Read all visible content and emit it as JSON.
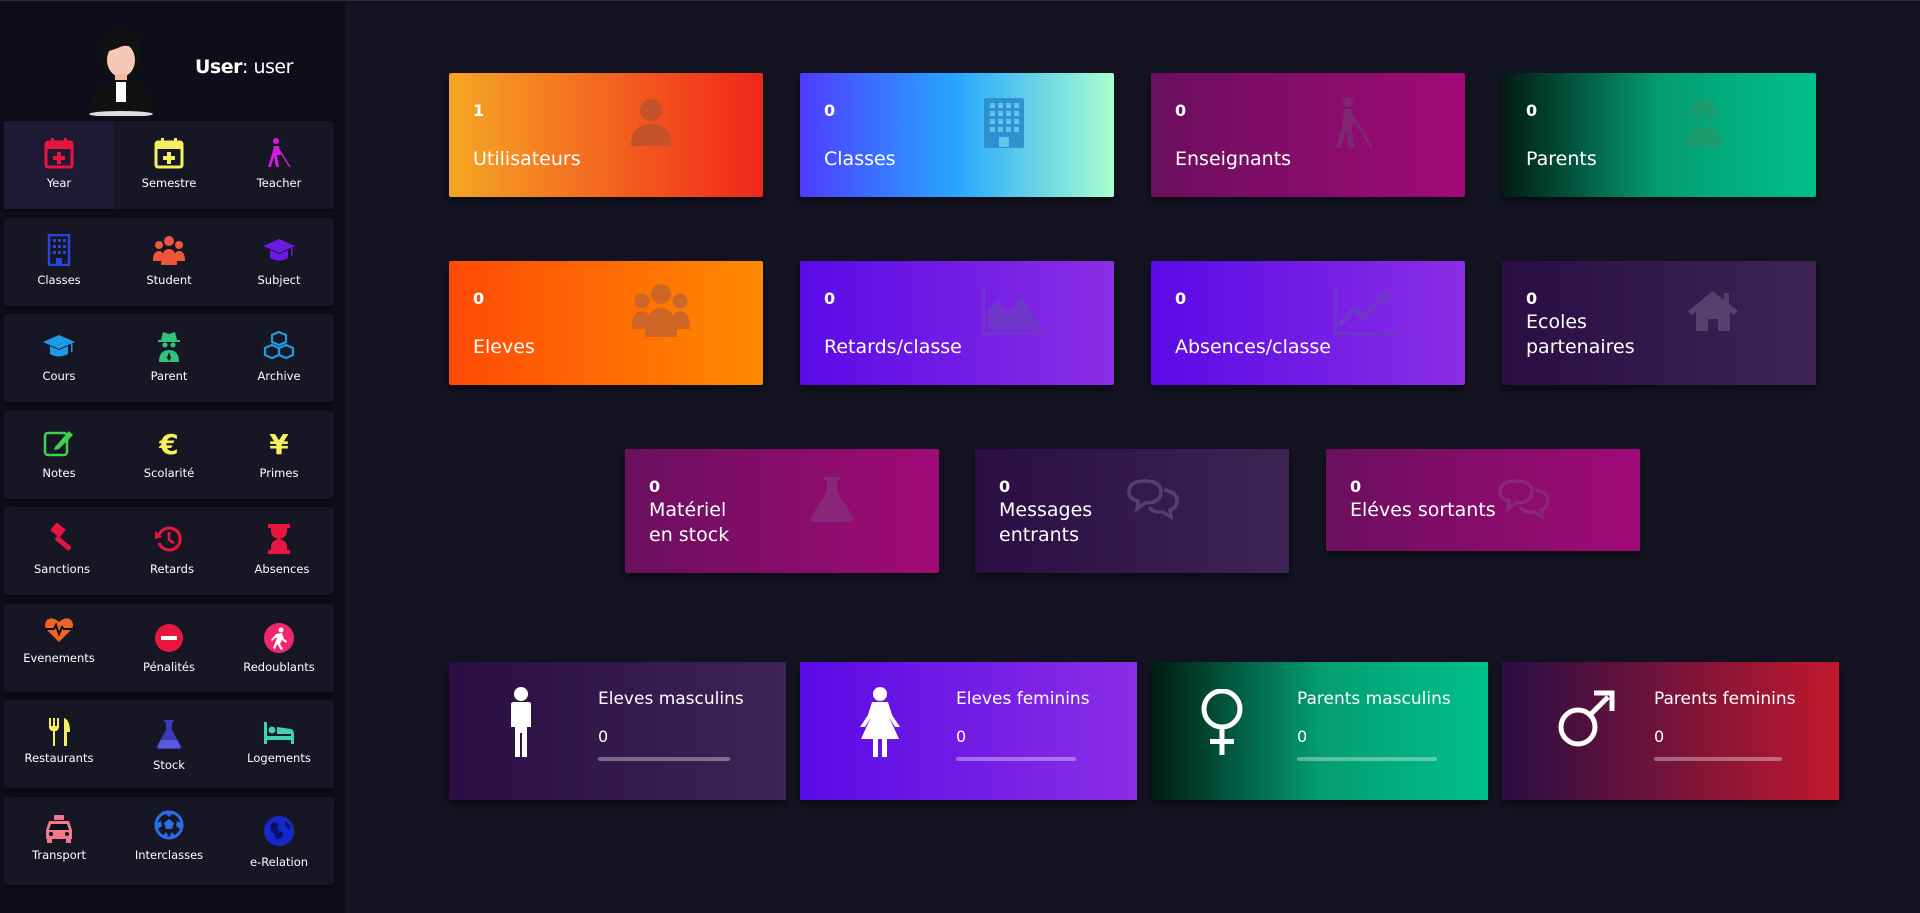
{
  "user": {
    "label": "User",
    "name": ": user"
  },
  "sidebar": {
    "rows": [
      [
        {
          "label": "Year",
          "icon": "calendar-plus-icon"
        },
        {
          "label": "Semestre",
          "icon": "calendar-plus-icon"
        },
        {
          "label": "Teacher",
          "icon": "blind-walker-icon"
        }
      ],
      [
        {
          "label": "Classes",
          "icon": "building-icon"
        },
        {
          "label": "Student",
          "icon": "users-icon"
        },
        {
          "label": "Subject",
          "icon": "graduation-cap-icon"
        }
      ],
      [
        {
          "label": "Cours",
          "icon": "graduation-cap-icon"
        },
        {
          "label": "Parent",
          "icon": "user-secret-icon"
        },
        {
          "label": "Archive",
          "icon": "cubes-icon"
        }
      ],
      [
        {
          "label": "Notes",
          "icon": "edit-icon"
        },
        {
          "label": "Scolarité",
          "icon": "euro-icon"
        },
        {
          "label": "Primes",
          "icon": "yen-icon"
        }
      ],
      [
        {
          "label": "Sanctions",
          "icon": "gavel-icon"
        },
        {
          "label": "Retards",
          "icon": "history-icon"
        },
        {
          "label": "Absences",
          "icon": "hourglass-icon"
        }
      ],
      [
        {
          "label": "Evenements",
          "icon": "heartbeat-icon"
        },
        {
          "label": "Pénalités",
          "icon": "minus-circle-icon"
        },
        {
          "label": "Redoublants",
          "icon": "repeat-walker-icon"
        }
      ],
      [
        {
          "label": "Restaurants",
          "icon": "utensils-icon"
        },
        {
          "label": "Stock",
          "icon": "flask-icon"
        },
        {
          "label": "Logements",
          "icon": "bed-icon"
        }
      ],
      [
        {
          "label": "Transport",
          "icon": "taxi-icon"
        },
        {
          "label": "Interclasses",
          "icon": "futbol-icon"
        },
        {
          "label": "e-Relation",
          "icon": "globe-icon"
        }
      ]
    ]
  },
  "cards": [
    {
      "count": "1",
      "label": "Utilisateurs",
      "icon": "user-icon",
      "gradient": [
        "#f5a623",
        "#f0261b"
      ]
    },
    {
      "count": "0",
      "label": "Classes",
      "icon": "building-icon",
      "gradient": [
        "#4e3cff",
        "#27a7ff",
        "#a8ffcf"
      ]
    },
    {
      "count": "0",
      "label": "Enseignants",
      "icon": "blind-walker-icon",
      "gradient": [
        "#6b0f5e",
        "#a10a78"
      ]
    },
    {
      "count": "0",
      "label": "Parents",
      "icon": "user-secret-icon",
      "gradient": [
        "#021a12",
        "#049d70",
        "#00c08a"
      ]
    },
    {
      "count": "0",
      "label": "Eleves",
      "icon": "users-icon",
      "gradient": [
        "#ff4a06",
        "#ff8a00"
      ]
    },
    {
      "count": "0",
      "label": "Retards/classe",
      "icon": "area-chart-icon",
      "gradient": [
        "#5a0ae6",
        "#8b2ee6"
      ]
    },
    {
      "count": "0",
      "label": "Absences/classe",
      "icon": "line-chart-icon",
      "gradient": [
        "#5a0ae6",
        "#8b2ee6"
      ]
    },
    {
      "count": "0",
      "label": "Ecoles\npartenaires",
      "icon": "home-icon",
      "gradient": [
        "#2a0e44",
        "#3e2455"
      ]
    },
    {
      "count": "0",
      "label": "Matériel\nen stock",
      "icon": "flask-icon",
      "gradient": [
        "#6b0f5e",
        "#a10a78"
      ]
    },
    {
      "count": "0",
      "label": "Messages\nentrants",
      "icon": "comments-icon",
      "gradient": [
        "#2a0e44",
        "#3e2455"
      ]
    },
    {
      "count": "0",
      "label": "Eléves sortants",
      "icon": "comments-icon",
      "gradient": [
        "#6b0f5e",
        "#a10a78"
      ]
    }
  ],
  "stats": [
    {
      "title": "Eleves masculins",
      "value": "0",
      "icon": "male-icon",
      "gradient": [
        "#2a0e44",
        "#3e2455"
      ]
    },
    {
      "title": "Eleves feminins",
      "value": "0",
      "icon": "female-icon",
      "gradient": [
        "#5a0ae6",
        "#8b2ee6"
      ]
    },
    {
      "title": "Parents masculins",
      "value": "0",
      "icon": "venus-icon",
      "gradient": [
        "#021a12",
        "#049d70",
        "#00c08a"
      ]
    },
    {
      "title": "Parents feminins",
      "value": "0",
      "icon": "mars-icon",
      "gradient": [
        "#2a0e44",
        "#c2182e"
      ]
    }
  ]
}
